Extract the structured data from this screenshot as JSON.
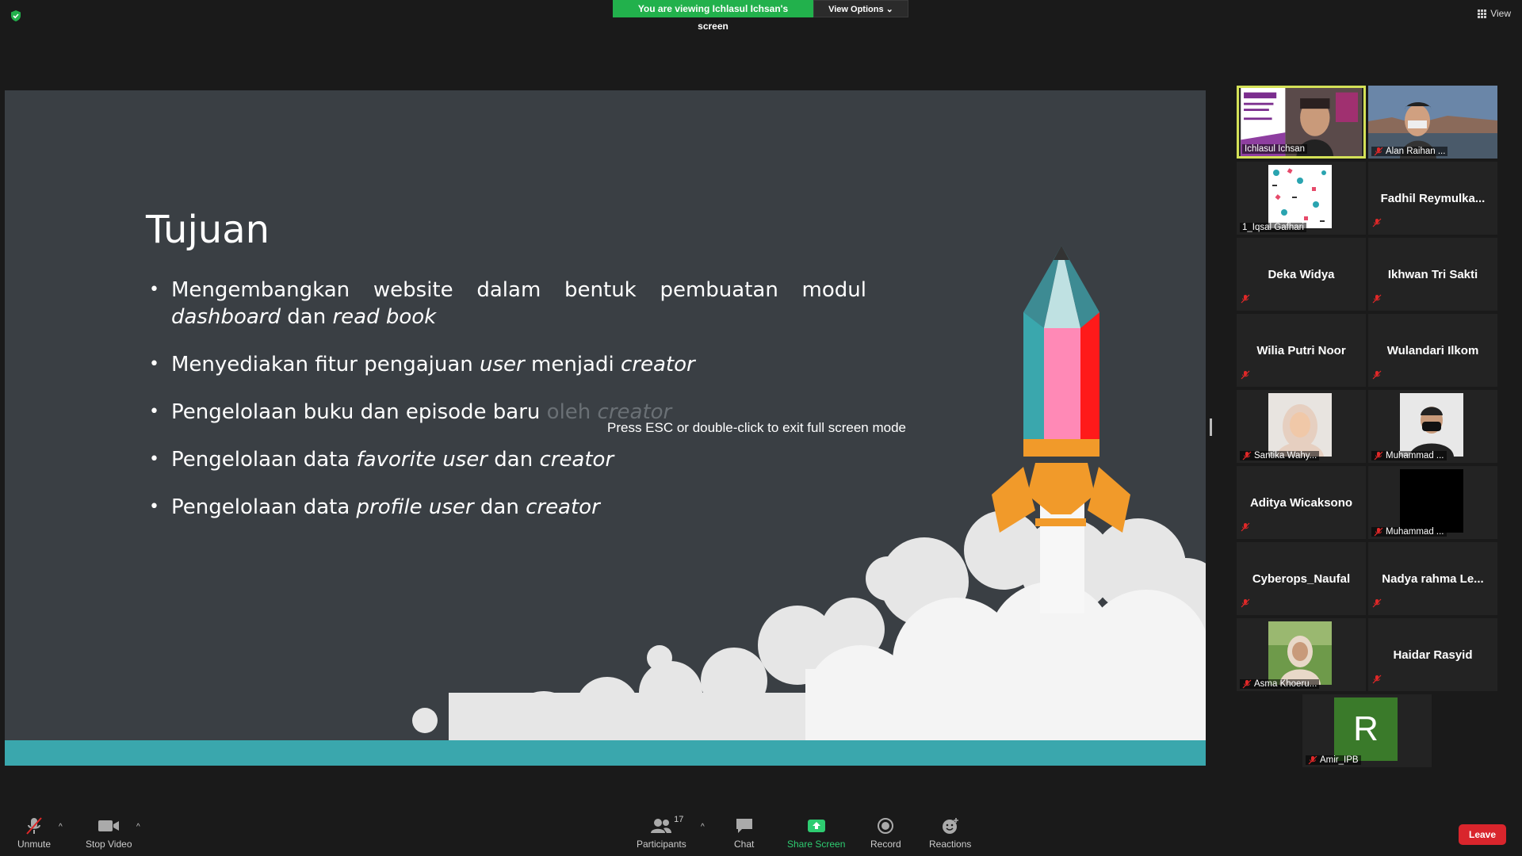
{
  "banner": {
    "viewing": "You are viewing Ichlasul Ichsan's screen",
    "view_options": "View Options",
    "view": "View"
  },
  "slide": {
    "title": "Tujuan",
    "bullet1_line1": "Mengembangkan website dalam bentuk pembuatan modul",
    "bullet1_line2a": "dashboard",
    "bullet1_line2b": " dan ",
    "bullet1_line2c": "read book",
    "bullet2a": "Menyediakan fitur pengajuan ",
    "bullet2b": "user",
    "bullet2c": " menjadi ",
    "bullet2d": "creator",
    "bullet3a": "Pengelolaan buku dan episode baru ",
    "bullet3b": "oleh ",
    "bullet3c": "creator",
    "bullet4a": "Pengelolaan data ",
    "bullet4b": "favorite user",
    "bullet4c": " dan ",
    "bullet4d": "creator",
    "bullet5a": "Pengelolaan data ",
    "bullet5b": "profile user",
    "bullet5c": " dan ",
    "bullet5d": "creator",
    "esc_message": "Press ESC or double-click to exit full screen mode"
  },
  "participants": [
    {
      "name": "Ichlasul Ichsan",
      "video": true,
      "muted": false
    },
    {
      "name": "Alan Raihan ...",
      "video": true,
      "muted": true
    },
    {
      "name": "1_Iqsal Gafhari",
      "video": true,
      "muted": false
    },
    {
      "name": "Fadhil  Reymulka...",
      "video": false,
      "muted": true
    },
    {
      "name": "Deka Widya",
      "video": false,
      "muted": true
    },
    {
      "name": "Ikhwan Tri Sakti",
      "video": false,
      "muted": true
    },
    {
      "name": "Wilia Putri Noor",
      "video": false,
      "muted": true
    },
    {
      "name": "Wulandari Ilkom",
      "video": false,
      "muted": true
    },
    {
      "name": "Santika Wahy...",
      "video": true,
      "muted": true
    },
    {
      "name": "Muhammad ...",
      "video": true,
      "muted": true
    },
    {
      "name": "Aditya Wicaksono",
      "video": false,
      "muted": true
    },
    {
      "name": "Muhammad ...",
      "video": true,
      "muted": true
    },
    {
      "name": "Cyberops_Naufal",
      "video": false,
      "muted": true
    },
    {
      "name": "Nadya rahma Le...",
      "video": false,
      "muted": true
    },
    {
      "name": "Asma Khoeru...",
      "video": true,
      "muted": true
    },
    {
      "name": "Haidar Rasyid",
      "video": false,
      "muted": true
    },
    {
      "name": "Amir_IPB",
      "avatar_letter": "R",
      "muted": true
    }
  ],
  "toolbar": {
    "unmute": "Unmute",
    "stop_video": "Stop Video",
    "participants": "Participants",
    "participants_count": "17",
    "chat": "Chat",
    "share_screen": "Share Screen",
    "record": "Record",
    "reactions": "Reactions",
    "leave": "Leave"
  },
  "colors": {
    "share_green": "#22b14c",
    "slide_bg": "#3a3f44",
    "teal": "#3aa7ad",
    "leave_red": "#d9252c",
    "active_border": "#d4e157"
  }
}
